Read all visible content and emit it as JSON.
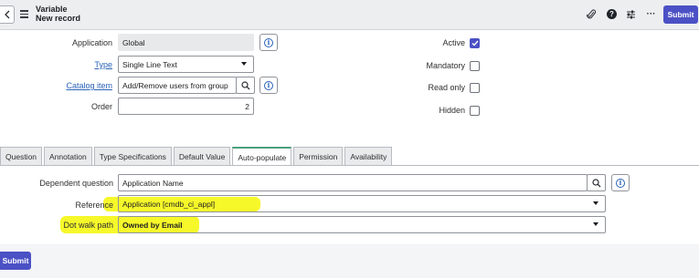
{
  "header": {
    "title": "Variable",
    "subtitle": "New record",
    "submit_label": "Submit",
    "icons": [
      "back-icon",
      "menu-icon",
      "paperclip-icon",
      "help-icon",
      "settings-sliders-icon",
      "more-icon"
    ]
  },
  "form": {
    "application": {
      "label": "Application",
      "value": "Global"
    },
    "type": {
      "label": "Type",
      "value": "Single Line Text"
    },
    "catalog_item": {
      "label": "Catalog item",
      "value": "Add/Remove users from group"
    },
    "order": {
      "label": "Order",
      "value": "2"
    },
    "active": {
      "label": "Active",
      "checked": true
    },
    "mandatory": {
      "label": "Mandatory",
      "checked": false
    },
    "read_only": {
      "label": "Read only",
      "checked": false
    },
    "hidden": {
      "label": "Hidden",
      "checked": false
    }
  },
  "tabs": [
    {
      "label": "Question",
      "active": false
    },
    {
      "label": "Annotation",
      "active": false
    },
    {
      "label": "Type Specifications",
      "active": false
    },
    {
      "label": "Default Value",
      "active": false
    },
    {
      "label": "Auto-populate",
      "active": true
    },
    {
      "label": "Permission",
      "active": false
    },
    {
      "label": "Availability",
      "active": false
    }
  ],
  "autopopulate": {
    "dependent_question": {
      "label": "Dependent question",
      "value": "Application Name"
    },
    "reference": {
      "label": "Reference",
      "value": "Application [cmdb_ci_appl]"
    },
    "dot_walk_path": {
      "label": "Dot walk path",
      "value": "Owned by Email"
    }
  },
  "footer": {
    "submit_label": "Submit"
  },
  "colors": {
    "accent": "#4b51c5",
    "highlight": "#f6f82a",
    "link": "#2a63b8",
    "active_tab": "#4aa07b"
  }
}
